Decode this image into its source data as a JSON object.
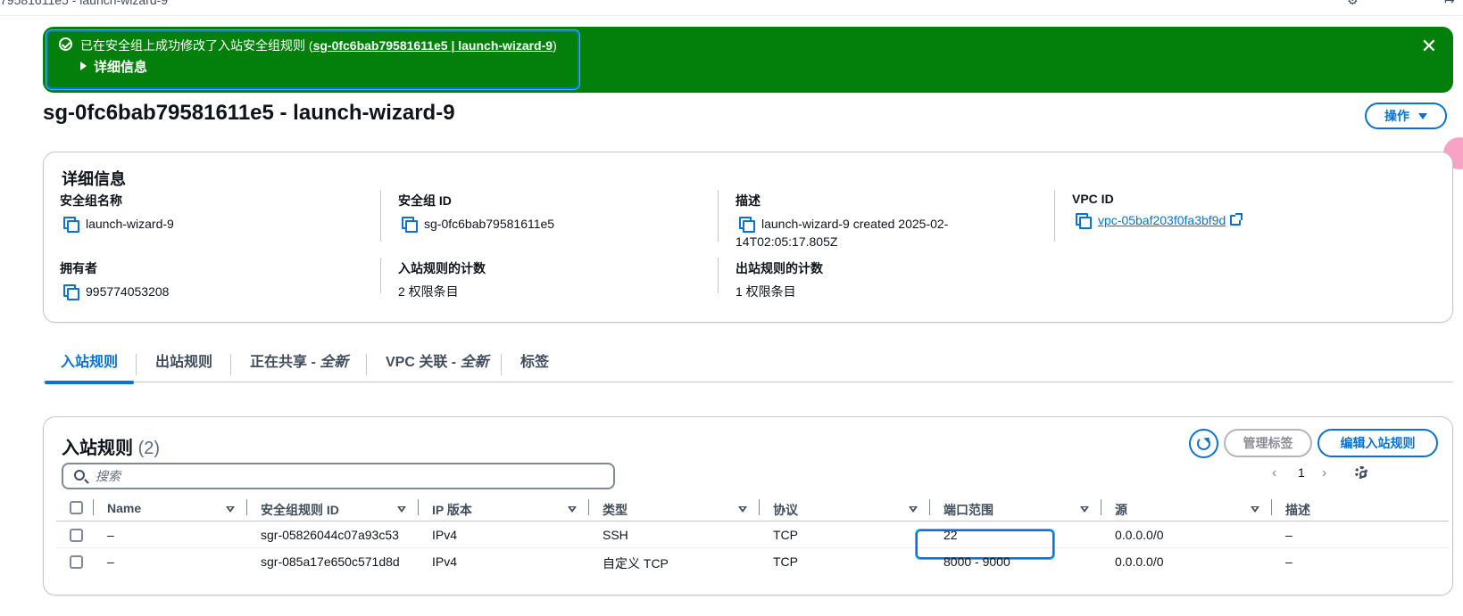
{
  "topbar": {
    "crumb": "79581611e5 - launch-wizard-9"
  },
  "flash": {
    "message_prefix": "已在安全组上成功修改了入站安全组规则 (",
    "message_link": "sg-0fc6bab79581611e5 | launch-wizard-9",
    "message_suffix": ")",
    "details_label": "详细信息",
    "close_icon": "close-icon",
    "color": "#037f0c"
  },
  "header": {
    "title": "sg-0fc6bab79581611e5 - launch-wizard-9",
    "actions_label": "操作"
  },
  "details": {
    "title": "详细信息",
    "fields": [
      {
        "label": "安全组名称",
        "value": "launch-wizard-9"
      },
      {
        "label": "安全组 ID",
        "value": "sg-0fc6bab79581611e5"
      },
      {
        "label": "描述",
        "value": "launch-wizard-9 created 2025-02-14T02:05:17.805Z"
      },
      {
        "label": "VPC ID",
        "value": "vpc-05baf203f0fa3bf9d"
      },
      {
        "label": "拥有者",
        "value": "995774053208"
      },
      {
        "label": "入站规则的计数",
        "value": "2 权限条目"
      },
      {
        "label": "出站规则的计数",
        "value": "1 权限条目"
      }
    ]
  },
  "tabs": [
    {
      "label": "入站规则",
      "suffix": ""
    },
    {
      "label": "出站规则",
      "suffix": ""
    },
    {
      "label": "正在共享 - ",
      "suffix": "全新"
    },
    {
      "label": "VPC 关联 - ",
      "suffix": "全新"
    },
    {
      "label": "标签",
      "suffix": ""
    }
  ],
  "rules": {
    "title": "入站规则",
    "count": "(2)",
    "manage_tags_label": "管理标签",
    "edit_label": "编辑入站规则",
    "search_placeholder": "搜索",
    "page": "1",
    "prev_icon": "chevron-left-icon",
    "next_icon": "chevron-right-icon",
    "columns": [
      "Name",
      "安全组规则 ID",
      "IP 版本",
      "类型",
      "协议",
      "端口范围",
      "源",
      "描述"
    ],
    "rows": [
      [
        "–",
        "sgr-05826044c07a93c53",
        "IPv4",
        "SSH",
        "TCP",
        "22",
        "0.0.0.0/0",
        "–"
      ],
      [
        "–",
        "sgr-085a17e650c571d8d",
        "IPv4",
        "自定义 TCP",
        "TCP",
        "8000 - 9000",
        "0.0.0.0/0",
        "–"
      ]
    ]
  },
  "colors": {
    "accent": "#0972d3",
    "success": "#037f0c"
  }
}
